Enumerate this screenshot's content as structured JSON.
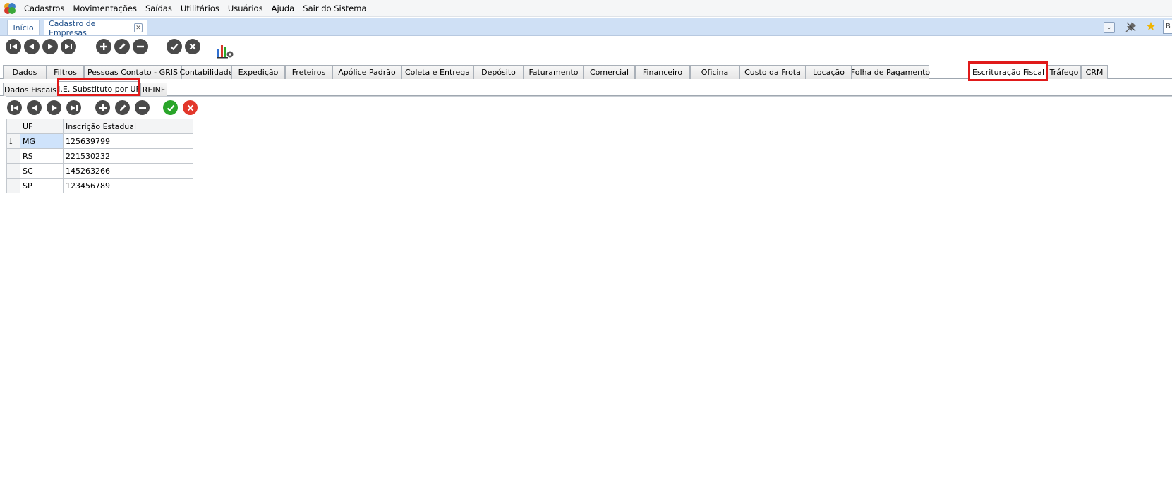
{
  "menu": {
    "items": [
      "Cadastros",
      "Movimentações",
      "Saídas",
      "Utilitários",
      "Usuários",
      "Ajuda",
      "Sair do Sistema"
    ]
  },
  "window_tabs": {
    "home": "Início",
    "current": "Cadastro de Empresas"
  },
  "top_right": {
    "input_value": "B"
  },
  "main_tabs": {
    "items": [
      "Dados",
      "Filtros",
      "Pessoas Contato - GRIS",
      "Contabilidade",
      "Expedição",
      "Freteiros",
      "Apólice Padrão",
      "Coleta e Entrega",
      "Depósito",
      "Faturamento",
      "Comercial",
      "Financeiro",
      "Oficina",
      "Custo da Frota",
      "Locação",
      "Folha de Pagamento",
      "Escrituração Fiscal",
      "Tráfego",
      "CRM"
    ],
    "active": "Escrituração Fiscal"
  },
  "sub_tabs": {
    "items": [
      "Dados Fiscais",
      "I.E. Substituto por UF",
      "REINF"
    ],
    "active": "I.E. Substituto por UF"
  },
  "grid": {
    "columns": [
      "UF",
      "Inscrição Estadual"
    ],
    "rows": [
      {
        "uf": "MG",
        "ie": "125639799"
      },
      {
        "uf": "RS",
        "ie": "221530232"
      },
      {
        "uf": "SC",
        "ie": "145263266"
      },
      {
        "uf": "SP",
        "ie": "123456789"
      }
    ],
    "selected_row": 0
  },
  "colors": {
    "highlight": "#e01a1a",
    "tab_bar": "#cfe0f5",
    "confirm": "#2aa52a",
    "cancel": "#e2372b"
  }
}
